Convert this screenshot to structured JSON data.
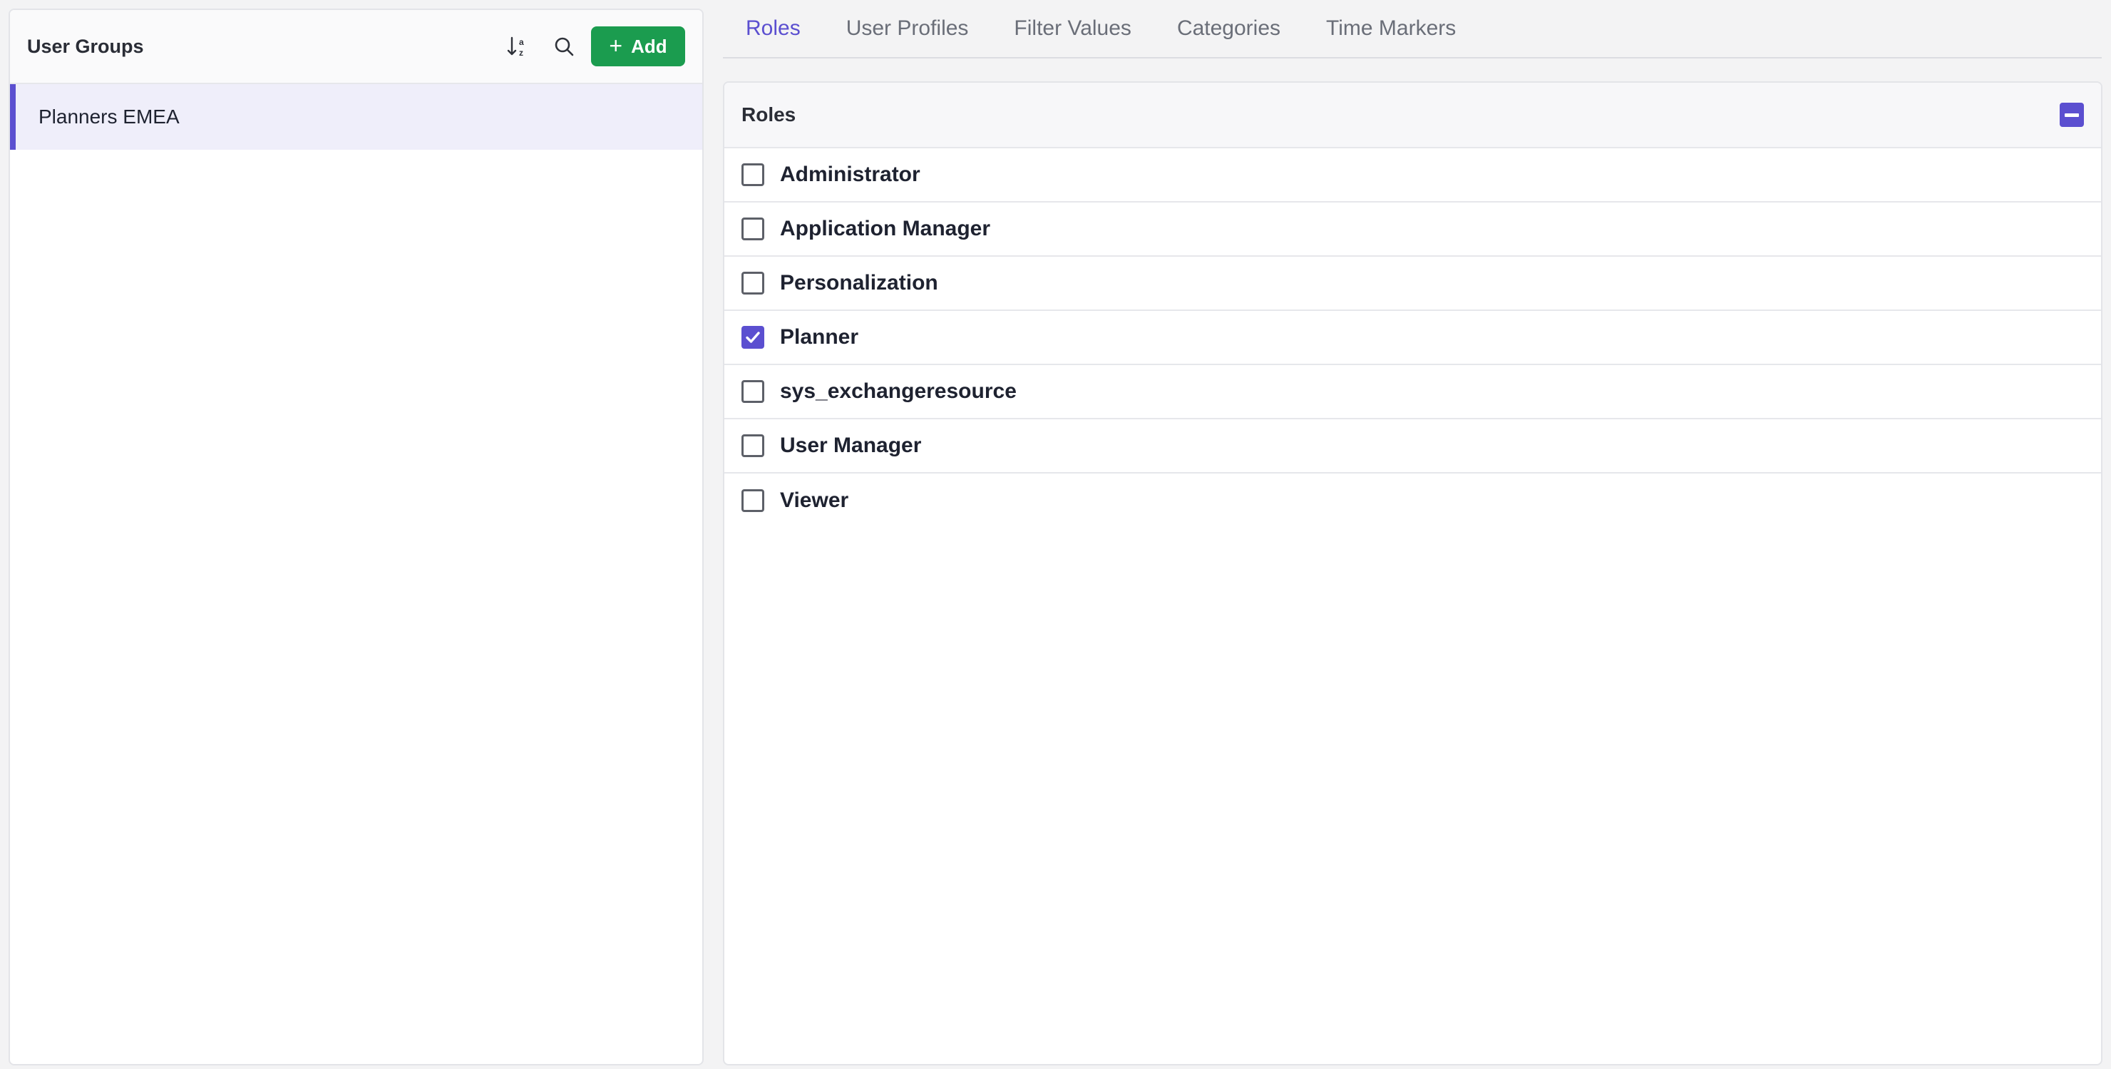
{
  "left_panel": {
    "title": "User Groups",
    "add_label": "Add",
    "groups": [
      {
        "label": "Planners EMEA",
        "selected": true
      }
    ]
  },
  "tabs": [
    {
      "label": "Roles",
      "active": true
    },
    {
      "label": "User Profiles",
      "active": false
    },
    {
      "label": "Filter Values",
      "active": false
    },
    {
      "label": "Categories",
      "active": false
    },
    {
      "label": "Time Markers",
      "active": false
    }
  ],
  "roles_card": {
    "title": "Roles",
    "roles": [
      {
        "label": "Administrator",
        "checked": false
      },
      {
        "label": "Application Manager",
        "checked": false
      },
      {
        "label": "Personalization",
        "checked": false
      },
      {
        "label": "Planner",
        "checked": true
      },
      {
        "label": "sys_exchangeresource",
        "checked": false
      },
      {
        "label": "User Manager",
        "checked": false
      },
      {
        "label": "Viewer",
        "checked": false
      }
    ]
  },
  "colors": {
    "accent": "#5b4fd0",
    "add_button": "#1b9c4f",
    "selected_row": "#efeefa"
  }
}
